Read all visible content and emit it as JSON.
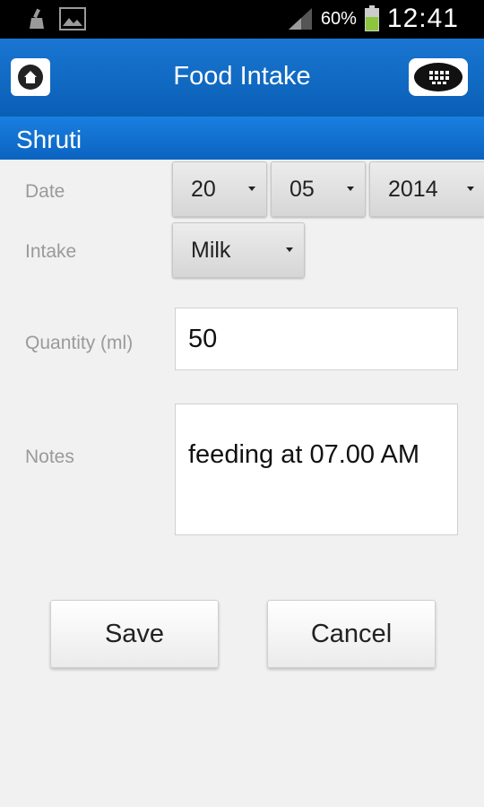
{
  "status_bar": {
    "battery_percent": "60%",
    "time": "12:41",
    "icons": [
      "cleaner-icon",
      "image-icon",
      "signal-icon",
      "battery-icon"
    ]
  },
  "app_bar": {
    "title": "Food Intake",
    "home_icon": "home-icon",
    "menu_icon": "grid-menu-icon"
  },
  "subheader": {
    "name": "Shruti"
  },
  "form": {
    "date_label": "Date",
    "date_day": "20",
    "date_month": "05",
    "date_year": "2014",
    "intake_label": "Intake",
    "intake_value": "Milk",
    "quantity_label": "Quantity (ml)",
    "quantity_value": "50",
    "notes_label": "Notes",
    "notes_value": "feeding at 07.00 AM"
  },
  "buttons": {
    "save": "Save",
    "cancel": "Cancel"
  },
  "colors": {
    "app_bar": "#1976d2",
    "subheader": "#0b63c0",
    "background": "#f1f1f1"
  }
}
